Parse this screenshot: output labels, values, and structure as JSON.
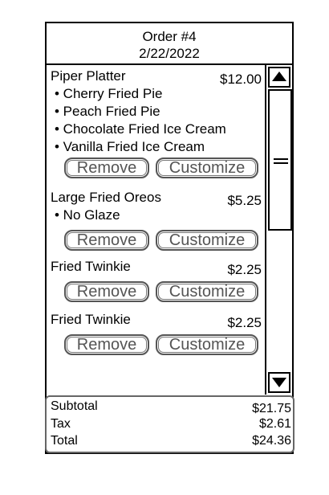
{
  "header": {
    "order_label": "Order #4",
    "date": "2/22/2022"
  },
  "items": [
    {
      "name": "Piper Platter",
      "price": "$12.00",
      "modifiers": [
        "• Cherry Fried Pie",
        "• Peach Fried Pie",
        "• Chocolate Fried Ice Cream",
        "• Vanilla Fried Ice Cream"
      ],
      "remove_label": "Remove",
      "customize_label": "Customize"
    },
    {
      "name": "Large Fried Oreos",
      "price": "$5.25",
      "modifiers": [
        "• No Glaze"
      ],
      "remove_label": "Remove",
      "customize_label": "Customize"
    },
    {
      "name": "Fried Twinkie",
      "price": "$2.25",
      "modifiers": [],
      "remove_label": "Remove",
      "customize_label": "Customize"
    },
    {
      "name": "Fried Twinkie",
      "price": "$2.25",
      "modifiers": [],
      "remove_label": "Remove",
      "customize_label": "Customize"
    }
  ],
  "totals": {
    "subtotal_label": "Subtotal",
    "subtotal": "$21.75",
    "tax_label": "Tax",
    "tax": "$2.61",
    "total_label": "Total",
    "total": "$24.36"
  },
  "icons": {
    "scroll_up": "triangle-up-icon",
    "scroll_down": "triangle-down-icon",
    "thumb_grip": "grip-lines-icon"
  }
}
